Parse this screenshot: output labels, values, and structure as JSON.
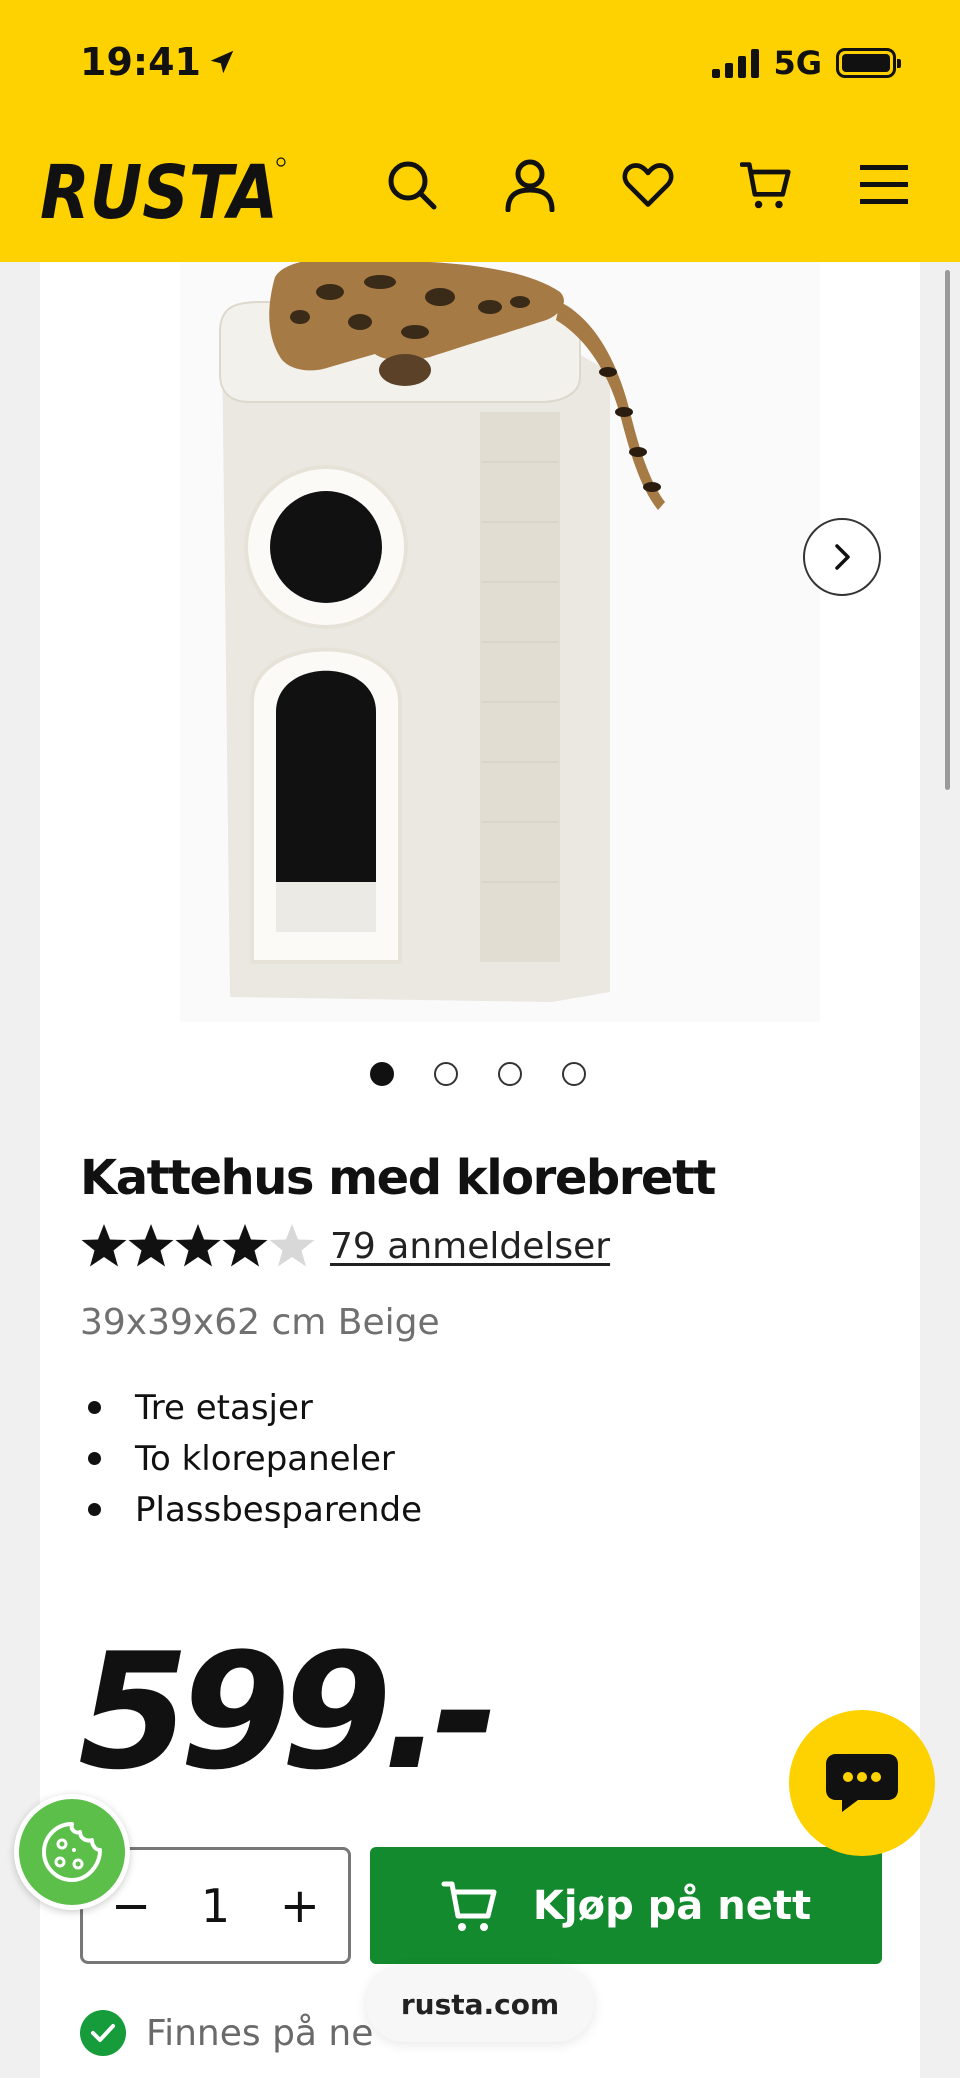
{
  "status_bar": {
    "time": "19:41",
    "network": "5G"
  },
  "header": {
    "logo_text": "RUSTA",
    "icons": [
      "search-icon",
      "account-icon",
      "heart-icon",
      "cart-icon",
      "menu-icon"
    ]
  },
  "gallery": {
    "image_count": 4,
    "active_index": 0
  },
  "product": {
    "title": "Kattehus med klorebrett",
    "rating": 4.6,
    "reviews_label": "79 anmeldelser",
    "subtitle": "39x39x62 cm Beige",
    "features": [
      "Tre etasjer",
      "To klorepaneler",
      "Plassbesparende"
    ],
    "price": "599.-"
  },
  "purchase": {
    "minus": "−",
    "quantity": "1",
    "plus": "+",
    "buy_label": "Kjøp på nett"
  },
  "stock": {
    "label": "Finnes på ne"
  },
  "browser": {
    "url": "rusta.com"
  },
  "colors": {
    "brand_yellow": "#fed100",
    "buy_green": "#138a2e",
    "check_green": "#169c3b"
  }
}
